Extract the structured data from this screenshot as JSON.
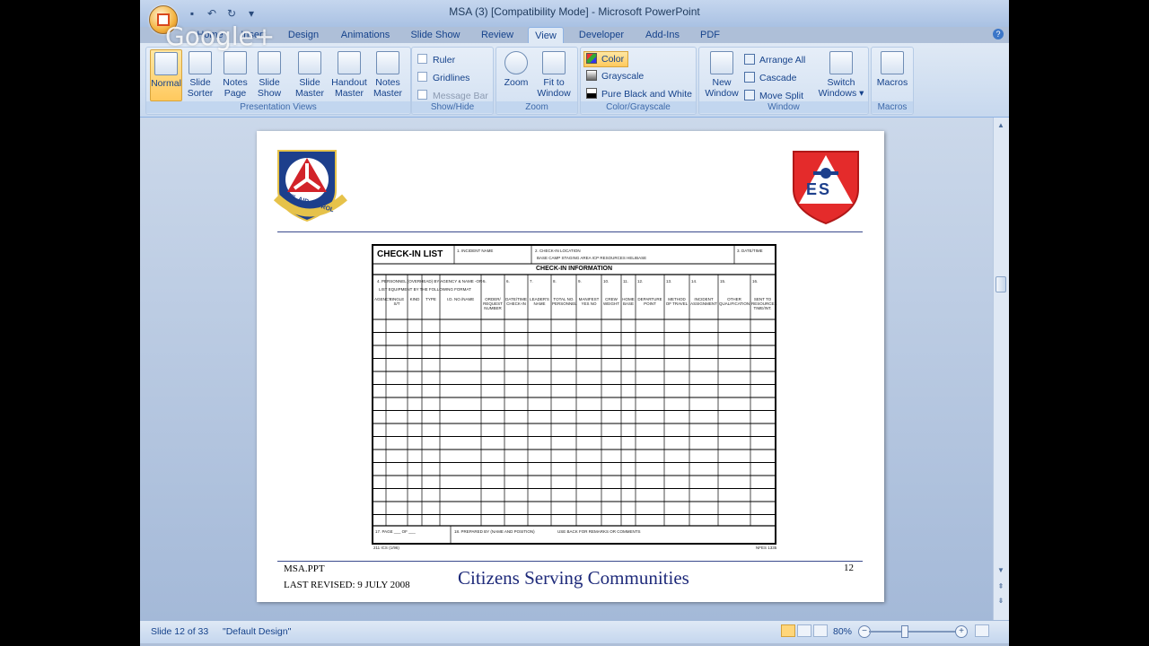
{
  "window": {
    "title": "MSA (3) [Compatibility Mode] - Microsoft PowerPoint"
  },
  "overlay": {
    "watermark": "Google+"
  },
  "tabs": [
    "Home",
    "Insert",
    "Design",
    "Animations",
    "Slide Show",
    "Review",
    "View",
    "Developer",
    "Add-Ins",
    "PDF"
  ],
  "active_tab": "View",
  "ribbon": {
    "presentation_views": {
      "label": "Presentation Views",
      "normal": "Normal",
      "slide_sorter": [
        "Slide",
        "Sorter"
      ],
      "notes_page": [
        "Notes",
        "Page"
      ],
      "slide_show": [
        "Slide",
        "Show"
      ],
      "slide_master": [
        "Slide",
        "Master"
      ],
      "handout_master": [
        "Handout",
        "Master"
      ],
      "notes_master": [
        "Notes",
        "Master"
      ]
    },
    "show_hide": {
      "label": "Show/Hide",
      "ruler": "Ruler",
      "gridlines": "Gridlines",
      "message_bar": "Message Bar"
    },
    "zoom": {
      "label": "Zoom",
      "zoom": "Zoom",
      "fit": [
        "Fit to",
        "Window"
      ]
    },
    "color": {
      "label": "Color/Grayscale",
      "color": "Color",
      "grayscale": "Grayscale",
      "pure": "Pure Black and White"
    },
    "window": {
      "label": "Window",
      "new_window": [
        "New",
        "Window"
      ],
      "arrange": "Arrange All",
      "cascade": "Cascade",
      "move_split": "Move Split",
      "switch": [
        "Switch",
        "Windows"
      ]
    },
    "macros": {
      "label": "Macros",
      "macros": "Macros"
    }
  },
  "slide": {
    "footer_left_1": "MSA.PPT",
    "footer_left_2": "LAST REVISED: 9 JULY 2008",
    "footer_title": "Citizens Serving Communities",
    "number": "12",
    "logo_left": "CIVIL AIR PATROL",
    "logo_right": "ES",
    "form": {
      "title": "CHECK-IN LIST",
      "section": "CHECK-IN INFORMATION",
      "incident": "1. INCIDENT NAME",
      "location": "2. CHECK-IN LOCATION",
      "loc_options": [
        "BASE",
        "CAMP",
        "STAGING AREA",
        "ICP RESOURCES",
        "HELIBASE"
      ],
      "date": "3. DATE/TIME",
      "personnel": "4. PERSONNEL (OVERHEAD) BY AGENCY & NAME -OR-",
      "format": "LIST EQUIPMENT BY THE FOLLOWING FORMAT",
      "cols": [
        "AGENCY",
        "SINGLE S/T",
        "KIND",
        "TYPE",
        "I.D. NO./NAME",
        "ORDER/ REQUEST NUMBER",
        "DATE/TIME CHECK-IN",
        "LEADER'S NAME",
        "TOTAL NO. PERSONNEL",
        "MANIFEST YES NO",
        "CREW WEIGHT",
        "HOME BASE",
        "DEPARTURE POINT",
        "METHOD OF TRAVEL",
        "INCIDENT ASSIGNMENT",
        "OTHER QUALIFICATION",
        "SENT TO RESOURCES TIME/INT."
      ],
      "col_nums": [
        "5.",
        "6.",
        "7.",
        "8.",
        "9.",
        "10.",
        "11.",
        "12.",
        "13.",
        "14.",
        "15.",
        "16."
      ],
      "page": "17. PAGE ___ OF ___",
      "prepared": "18. PREPARED BY (NAME AND POSITION)",
      "remarks": "USE BACK FOR REMARKS OR COMMENTS",
      "form_id": "211 ICS (1/96)",
      "nfes": "NFES 1335"
    }
  },
  "status": {
    "slide": "Slide 12 of 33",
    "theme": "\"Default Design\"",
    "zoom": "80%"
  }
}
